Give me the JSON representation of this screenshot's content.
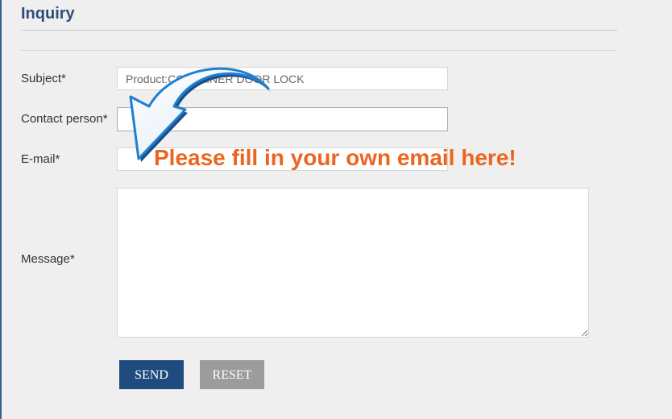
{
  "form": {
    "title": "Inquiry",
    "subject_label": "Subject*",
    "subject_value": "Product:CONTAINER DOOR LOCK",
    "contact_label": "Contact person*",
    "contact_value": "",
    "email_label": "E-mail*",
    "email_value": "",
    "message_label": "Message*",
    "message_value": "",
    "send_label": "SEND",
    "reset_label": "RESET"
  },
  "annotation": {
    "text": "Please fill in your own email here!",
    "icon": "curved-arrow-icon",
    "text_color": "#ec6520",
    "arrow_color": "#1f7fd0"
  },
  "colors": {
    "title": "#2e4d78",
    "send_button": "#1f4b80",
    "reset_button": "#9c9c9c",
    "background": "#efefef"
  }
}
